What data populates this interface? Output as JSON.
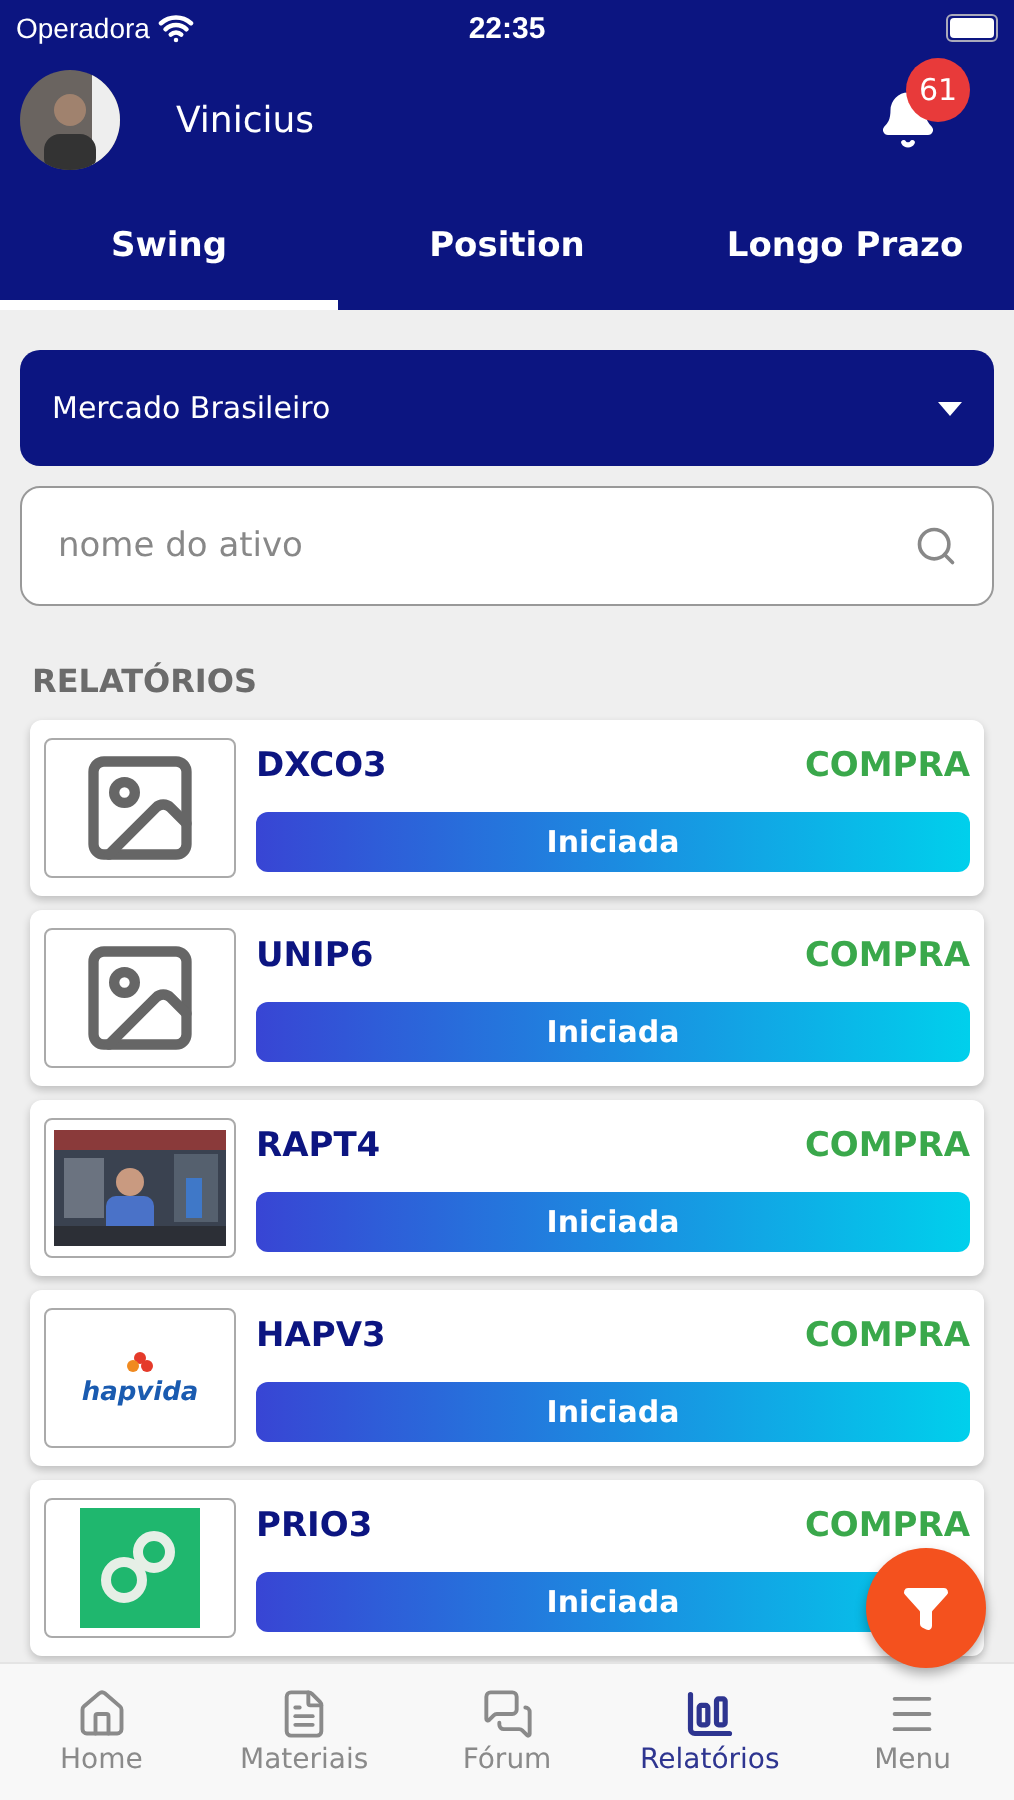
{
  "status_bar": {
    "carrier": "Operadora",
    "time": "22:35"
  },
  "header": {
    "user_name": "Vinicius",
    "notification_count": "61"
  },
  "tabs": [
    {
      "label": "Swing",
      "selected": true
    },
    {
      "label": "Position",
      "selected": false
    },
    {
      "label": "Longo Prazo",
      "selected": false
    }
  ],
  "market_select": {
    "value": "Mercado Brasileiro"
  },
  "search": {
    "placeholder": "nome do ativo"
  },
  "section_title": "RELATÓRIOS",
  "reports": [
    {
      "ticker": "DXCO3",
      "signal": "COMPRA",
      "status": "Iniciada",
      "thumb": {
        "kind": "placeholder"
      }
    },
    {
      "ticker": "UNIP6",
      "signal": "COMPRA",
      "status": "Iniciada",
      "thumb": {
        "kind": "placeholder"
      }
    },
    {
      "ticker": "RAPT4",
      "signal": "COMPRA",
      "status": "Iniciada"
    },
    {
      "ticker": "HAPV3",
      "signal": "COMPRA",
      "status": "Iniciada",
      "thumb": {
        "kind": "hapvida",
        "text": "hapvida"
      }
    },
    {
      "ticker": "PRIO3",
      "signal": "COMPRA",
      "status": "Iniciada",
      "thumb": {
        "kind": "prio"
      }
    }
  ],
  "bottom_nav": [
    {
      "label": "Home",
      "selected": false
    },
    {
      "label": "Materiais",
      "selected": false
    },
    {
      "label": "Fórum",
      "selected": false
    },
    {
      "label": "Relatórios",
      "selected": true
    },
    {
      "label": "Menu",
      "selected": false
    }
  ]
}
